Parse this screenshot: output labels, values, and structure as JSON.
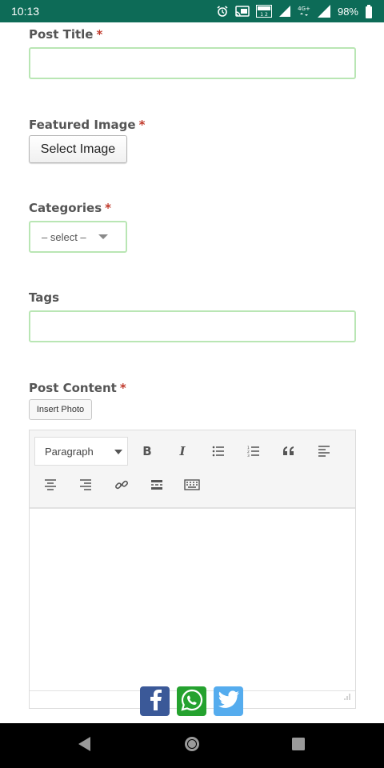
{
  "status_bar": {
    "time": "10:13",
    "battery": "98%",
    "icons": [
      "alarm-icon",
      "cast-icon",
      "volte-icon",
      "signal-icon",
      "4g-icon",
      "signal-icon",
      "battery-icon"
    ]
  },
  "form": {
    "post_title": {
      "label": "Post Title",
      "required_mark": "*",
      "value": ""
    },
    "featured_image": {
      "label": "Featured Image",
      "required_mark": "*",
      "button": "Select Image"
    },
    "categories": {
      "label": "Categories",
      "required_mark": "*",
      "selected": "– select –"
    },
    "tags": {
      "label": "Tags",
      "value": ""
    },
    "post_content": {
      "label": "Post Content",
      "required_mark": "*",
      "insert_photo": "Insert Photo",
      "format_selected": "Paragraph",
      "toolbar_icons": [
        "bold-icon",
        "italic-icon",
        "bullet-list-icon",
        "numbered-list-icon",
        "blockquote-icon",
        "align-left-icon",
        "align-center-icon",
        "align-right-icon",
        "link-icon",
        "read-more-icon",
        "keyboard-icon"
      ]
    }
  },
  "share": [
    "facebook-icon",
    "whatsapp-icon",
    "twitter-icon"
  ],
  "colors": {
    "status_bar": "#0d6b57",
    "input_border": "#b9e6b4",
    "required": "#c0392b",
    "facebook": "#3b5998",
    "whatsapp": "#25a22f",
    "twitter": "#55acee"
  }
}
